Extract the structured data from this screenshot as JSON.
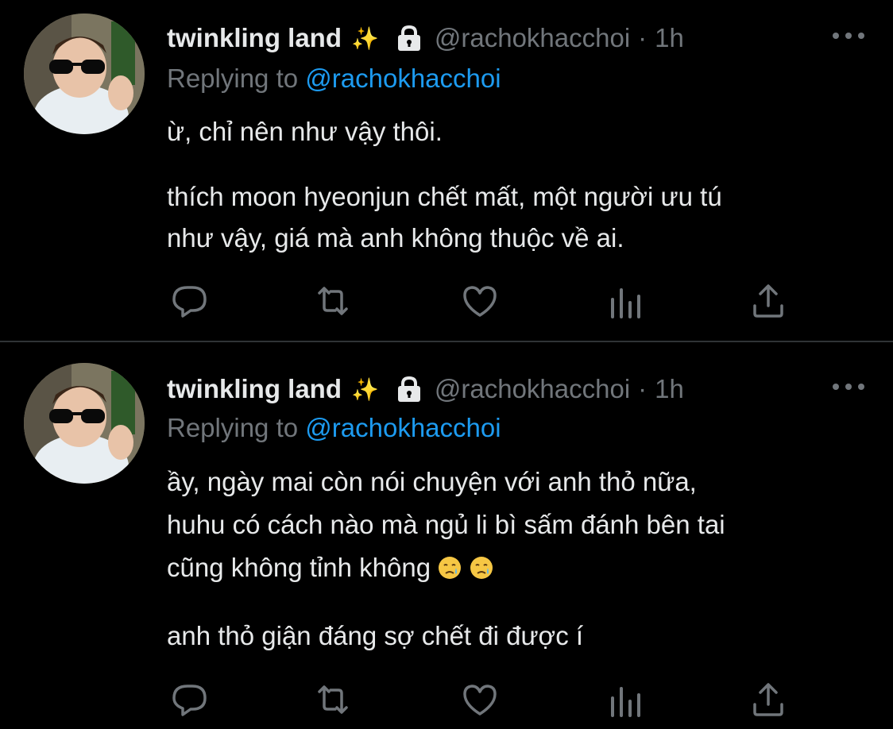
{
  "tweets": [
    {
      "display_name": "twinkling land",
      "name_emoji": "✨",
      "handle": "@rachokhacchoi",
      "separator": "·",
      "time": "1h",
      "replying_prefix": "Replying to",
      "replying_to": "@rachokhacchoi",
      "lines": [
        "ừ, chỉ nên như vậy thôi.",
        "",
        "thích moon hyeonjun chết mất, một người ưu tú",
        "như vậy, giá mà anh không thuộc về ai."
      ]
    },
    {
      "display_name": "twinkling land",
      "name_emoji": "✨",
      "handle": "@rachokhacchoi",
      "separator": "·",
      "time": "1h",
      "replying_prefix": "Replying to",
      "replying_to": "@rachokhacchoi",
      "lines": [
        "ầy, ngày mai còn nói chuyện với anh thỏ nữa,",
        "huhu có cách nào mà ngủ li bì sấm đánh bên tai",
        "cũng không tỉnh không",
        "",
        "anh thỏ giận đáng sợ chết đi được í"
      ],
      "line_emojis": [
        "crying-face",
        "crying-face"
      ]
    }
  ],
  "icons": [
    "reply-icon",
    "retweet-icon",
    "like-icon",
    "analytics-icon",
    "share-icon"
  ],
  "colors": {
    "background": "#000000",
    "text": "#e7e9ea",
    "muted": "#71767b",
    "link": "#1d9bf0",
    "divider": "#2f3336"
  }
}
